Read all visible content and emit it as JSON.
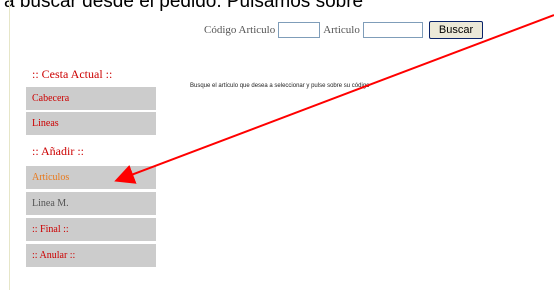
{
  "banner": {
    "text": "a buscar desde el pedido. Pulsamos sobre"
  },
  "search": {
    "codigo_label": "Código Articulo",
    "codigo_value": "",
    "articulo_label": "Articulo",
    "articulo_value": "",
    "button_label": "Buscar"
  },
  "cesta": {
    "title": ":: Cesta Actual ::",
    "items": [
      {
        "label": "Cabecera"
      },
      {
        "label": "Lineas"
      }
    ]
  },
  "anadir": {
    "title": ":: Añadir ::",
    "items": [
      {
        "label": "Articulos"
      },
      {
        "label": "Linea M."
      },
      {
        "label": ":: Final ::"
      },
      {
        "label": ":: Anular ::"
      }
    ]
  },
  "hint": "Busque el artículo que desea a seleccionar y pulse sobre su código",
  "colors": {
    "menu_bg": "#cccccc",
    "menu_red": "#cc0000",
    "menu_orange": "#e87a1e",
    "menu_gray": "#555555",
    "arrow": "#ff0000"
  }
}
